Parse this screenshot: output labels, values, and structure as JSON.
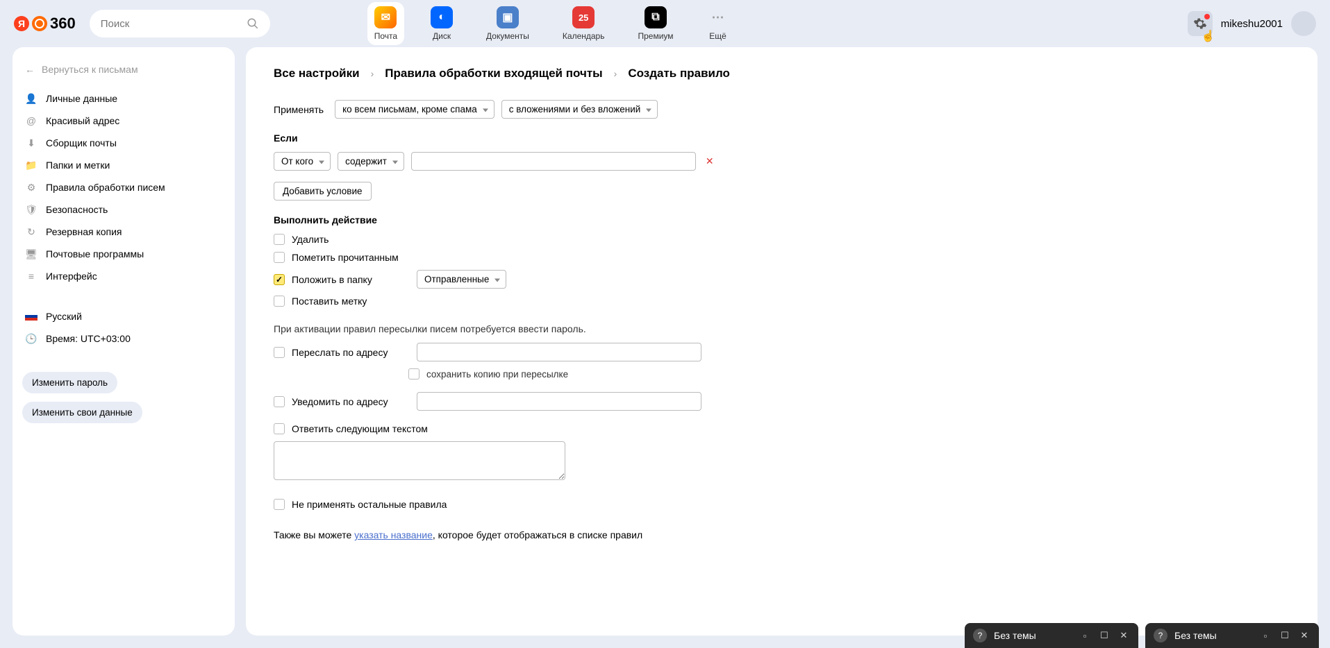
{
  "header": {
    "logo_text": "360",
    "search_placeholder": "Поиск",
    "apps": [
      {
        "label": "Почта"
      },
      {
        "label": "Диск"
      },
      {
        "label": "Документы"
      },
      {
        "label": "Календарь",
        "badge": "25"
      },
      {
        "label": "Премиум"
      },
      {
        "label": "Ещё"
      }
    ],
    "username": "mikeshu2001"
  },
  "sidebar": {
    "back": "Вернуться к письмам",
    "items": [
      {
        "label": "Личные данные"
      },
      {
        "label": "Красивый адрес"
      },
      {
        "label": "Сборщик почты"
      },
      {
        "label": "Папки и метки"
      },
      {
        "label": "Правила обработки писем"
      },
      {
        "label": "Безопасность"
      },
      {
        "label": "Резервная копия"
      },
      {
        "label": "Почтовые программы"
      },
      {
        "label": "Интерфейс"
      }
    ],
    "language": "Русский",
    "timezone": "Время: UTC+03:00",
    "change_password": "Изменить пароль",
    "change_data": "Изменить свои данные"
  },
  "breadcrumb": {
    "a": "Все настройки",
    "b": "Правила обработки входящей почты",
    "c": "Создать правило"
  },
  "form": {
    "apply_label": "Применять",
    "apply_sel1": "ко всем письмам, кроме спама",
    "apply_sel2": "с вложениями и без вложений",
    "if_label": "Если",
    "cond_field": "От кого",
    "cond_op": "содержит",
    "add_condition": "Добавить условие",
    "action_title": "Выполнить действие",
    "act_delete": "Удалить",
    "act_read": "Пометить прочитанным",
    "act_folder": "Положить в папку",
    "folder_sel": "Отправленные",
    "act_label": "Поставить метку",
    "forward_hint": "При активации правил пересылки писем потребуется ввести пароль.",
    "act_forward": "Переслать по адресу",
    "act_savecopy": "сохранить копию при пересылке",
    "act_notify": "Уведомить по адресу",
    "act_reply": "Ответить следующим текстом",
    "act_skip": "Не применять остальные правила",
    "note_prefix": "Также вы можете ",
    "note_link": "указать название",
    "note_suffix": ", которое будет отображаться в списке правил"
  },
  "popups": {
    "title": "Без темы"
  }
}
